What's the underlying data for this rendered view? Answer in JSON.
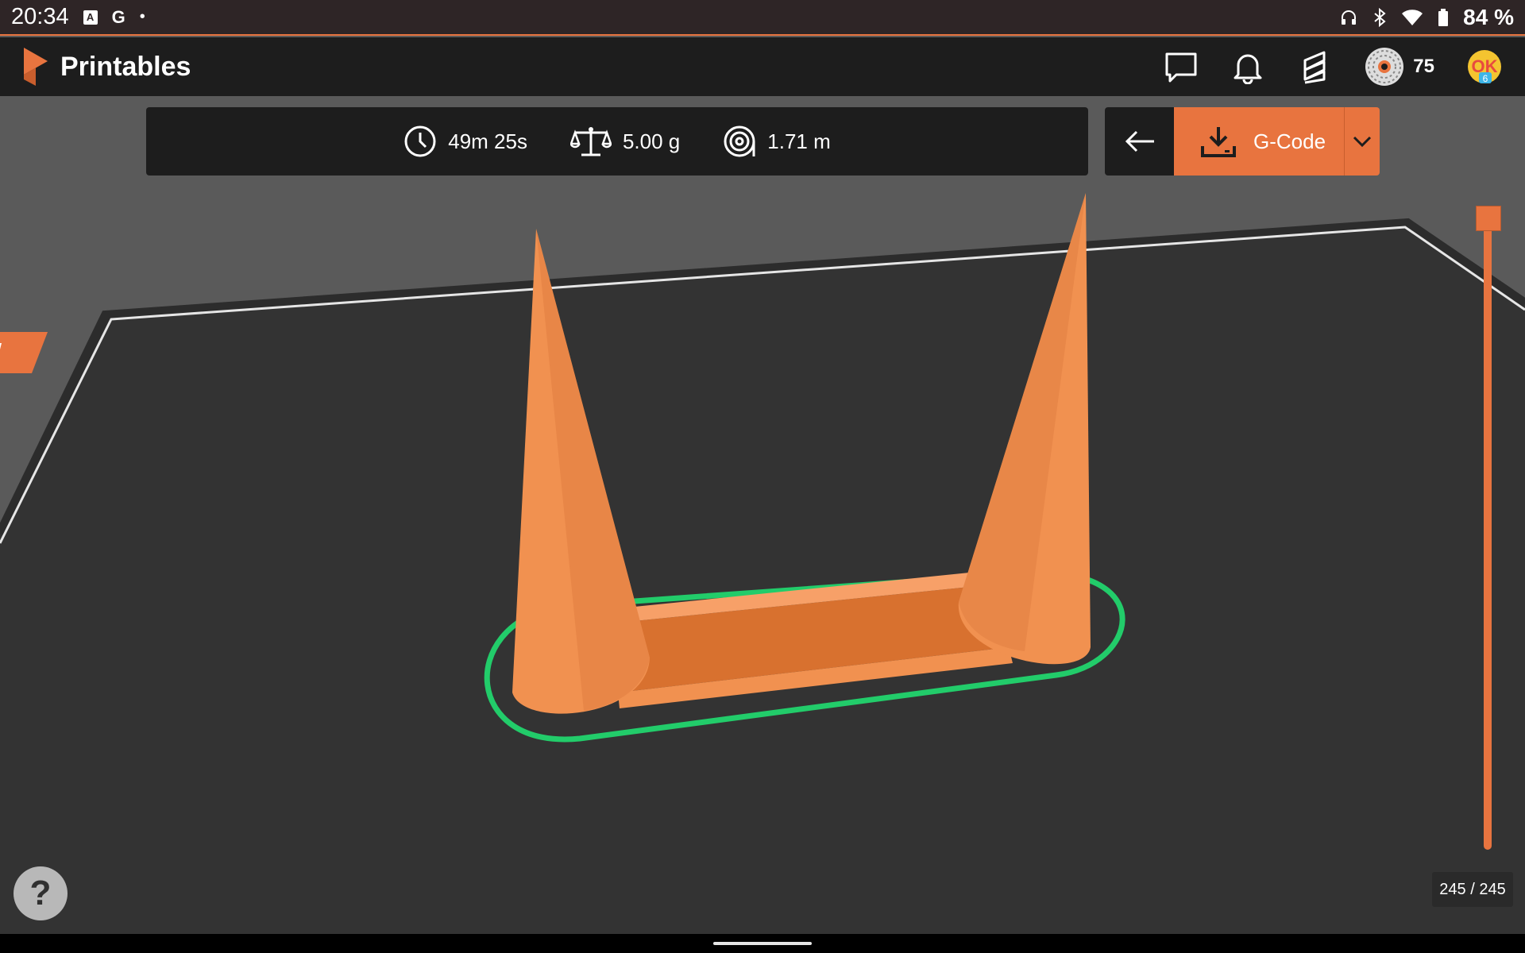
{
  "status_bar": {
    "time": "20:34",
    "notif_icons": [
      "a-icon",
      "google-icon",
      "dot-icon"
    ],
    "system_icons": [
      "headphones-icon",
      "bluetooth-icon",
      "wifi-icon",
      "battery-icon"
    ],
    "battery": "84 %"
  },
  "header": {
    "brand": "Printables",
    "icons": [
      "chat-icon",
      "bell-icon",
      "slicer-icon"
    ],
    "credits": "75",
    "avatar_badge": "6"
  },
  "stats": {
    "time": "49m 25s",
    "weight": "5.00 g",
    "filament": "1.71 m"
  },
  "actions": {
    "download_label": "G-Code"
  },
  "layer_slider": {
    "count": "245 / 245",
    "current_layer": 245,
    "total_layers": 245
  },
  "help": {
    "label": "?"
  },
  "colors": {
    "accent": "#e8743f",
    "model": "#f19150",
    "brim": "#22cc6a",
    "bed": "#333333",
    "header": "#1d1d1d"
  }
}
